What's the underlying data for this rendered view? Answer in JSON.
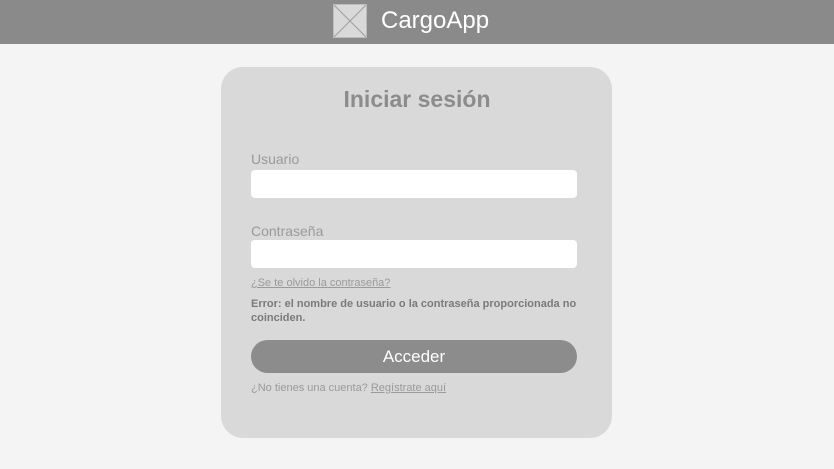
{
  "header": {
    "app_title": "CargoApp",
    "logo_icon": "image-placeholder-icon",
    "background_color": "#8a8a8a"
  },
  "login": {
    "title": "Iniciar sesión",
    "username": {
      "label": "Usuario",
      "value": "",
      "placeholder": ""
    },
    "password": {
      "label": "Contraseña",
      "value": "",
      "placeholder": ""
    },
    "forgot_password_link": "¿Se te olvido la contraseña?",
    "error_message": "Error: el nombre de usuario o la contraseña proporcionada no coinciden.",
    "submit_label": "Acceder",
    "register_prompt": "¿No tienes una cuenta?",
    "register_link": "Regístrate aquí"
  },
  "colors": {
    "page_background": "#f4f4f4",
    "card_background": "#d9d9d9",
    "button_background": "#8c8c8c"
  }
}
